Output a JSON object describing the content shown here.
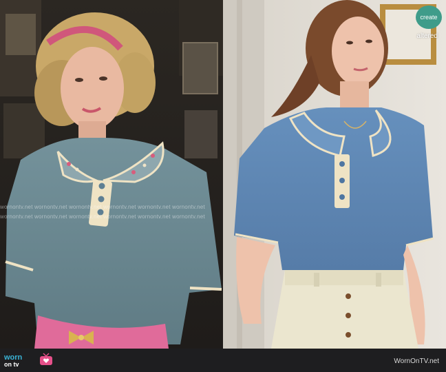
{
  "watermark": {
    "text": "wornontv.net wornontv.net wornontv.net wornontv.net wornontv.net wornontv.net"
  },
  "seal": {
    "logo": "create",
    "label": "altered"
  },
  "footer": {
    "brand_top": "worn",
    "brand_bottom": "on tv",
    "credit": "WornOnTV.net",
    "icon": "tv-heart-icon"
  },
  "colors": {
    "sweater_left": "#6e8b94",
    "sweater_right": "#5e87b4",
    "trim": "#efe3c4",
    "belt": "#e06b9a",
    "seal": "#3f9c8a",
    "brand": "#3ab3d6"
  }
}
